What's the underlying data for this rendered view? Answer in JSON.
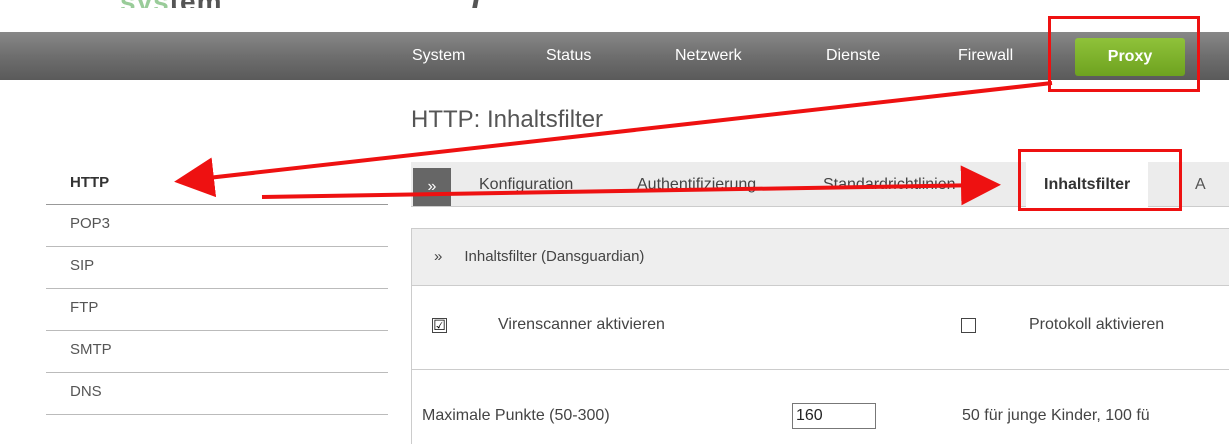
{
  "logo": {
    "text_light": "sys",
    "text_dark": "tem",
    "slash": "/"
  },
  "topnav": {
    "items": [
      "System",
      "Status",
      "Netzwerk",
      "Dienste",
      "Firewall"
    ],
    "active": "Proxy"
  },
  "page_title": "HTTP: Inhaltsfilter",
  "sidebar": {
    "items": [
      "HTTP",
      "POP3",
      "SIP",
      "FTP",
      "SMTP",
      "DNS"
    ]
  },
  "tabs": {
    "chevron": "»",
    "items": [
      "Konfiguration",
      "Authentifizierung",
      "Standardrichtlinien"
    ],
    "selected": "Inhaltsfilter",
    "overflow": "A"
  },
  "panel": {
    "chevron": "»",
    "header": "Inhaltsfilter (Dansguardian)",
    "virenscanner_label": "Virenscanner aktivieren",
    "virenscanner_checked": "☑",
    "protokoll_label": "Protokoll aktivieren",
    "max_points_label": "Maximale Punkte (50-300)",
    "max_points_value": "160",
    "hint": "50 für junge Kinder, 100 fü"
  },
  "colors": {
    "accent_green": "#7ab52a",
    "annotation_red": "#e11111"
  }
}
